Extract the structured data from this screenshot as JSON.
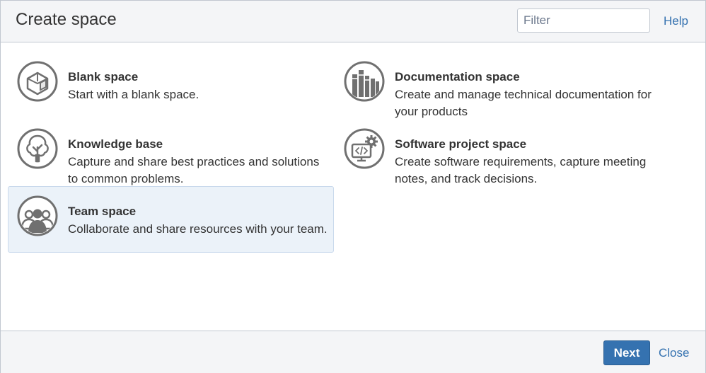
{
  "dialog": {
    "title": "Create space",
    "filter_placeholder": "Filter",
    "help_label": "Help"
  },
  "templates": [
    {
      "id": "blank",
      "name": "Blank space",
      "description": "Start with a blank space.",
      "icon": "blank-page-icon"
    },
    {
      "id": "documentation",
      "name": "Documentation space",
      "description": "Create and manage technical documentation for your products",
      "icon": "books-icon"
    },
    {
      "id": "knowledge",
      "name": "Knowledge base",
      "description": "Capture and share best practices and solutions to common problems.",
      "icon": "tree-icon"
    },
    {
      "id": "software",
      "name": "Software project space",
      "description": "Create software requirements, capture meeting notes, and track decisions.",
      "icon": "code-monitor-gear-icon"
    },
    {
      "id": "team",
      "name": "Team space",
      "description": "Collaborate and share resources with your team.",
      "icon": "team-people-icon",
      "selected": true
    }
  ],
  "footer": {
    "next_label": "Next",
    "close_label": "Close"
  },
  "colors": {
    "accent": "#3572b0",
    "icon_gray": "#707070",
    "selected_bg": "#ebf2f9"
  }
}
